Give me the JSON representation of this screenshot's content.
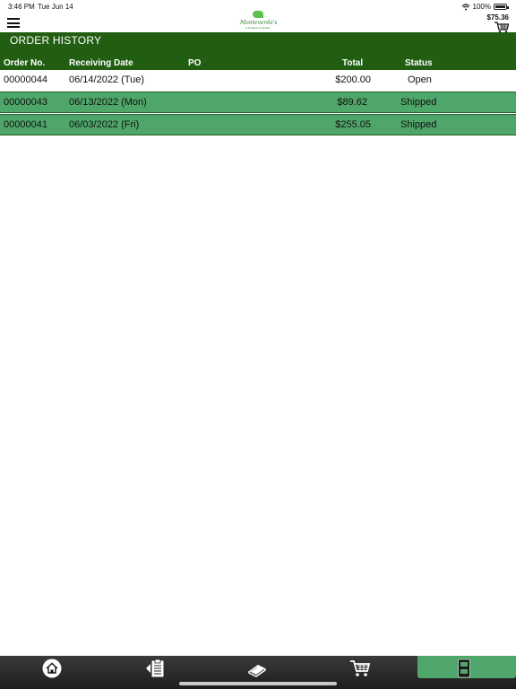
{
  "status_bar": {
    "time": "3:46 PM",
    "date": "Tue Jun 14",
    "battery": "100%"
  },
  "navbar": {
    "logo_name": "Monteverde's",
    "logo_sub": "& Produce & Garden",
    "cart_amount": "$75.36"
  },
  "page": {
    "title": "ORDER HISTORY",
    "columns": {
      "order_no": "Order No.",
      "receiving_date": "Receiving Date",
      "po": "PO",
      "total": "Total",
      "status": "Status"
    }
  },
  "orders": [
    {
      "order_no": "00000044",
      "receiving_date": "06/14/2022 (Tue)",
      "po": "",
      "total": "$200.00",
      "status": "Open"
    },
    {
      "order_no": "00000043",
      "receiving_date": "06/13/2022 (Mon)",
      "po": "",
      "total": "$89.62",
      "status": "Shipped"
    },
    {
      "order_no": "00000041",
      "receiving_date": "06/03/2022 (Fri)",
      "po": "",
      "total": "$255.05",
      "status": "Shipped"
    }
  ],
  "tab_bar": {
    "tabs": [
      {
        "name": "home",
        "icon": "home-icon"
      },
      {
        "name": "order-list",
        "icon": "clipboard-icon"
      },
      {
        "name": "catalog",
        "icon": "book-icon"
      },
      {
        "name": "cart",
        "icon": "cart-icon"
      },
      {
        "name": "account",
        "icon": "phone-icon"
      }
    ],
    "active_tab": "account"
  },
  "colors": {
    "header_green": "#225e12",
    "row_green": "#4fa66a",
    "accent": "#5cc24b"
  }
}
